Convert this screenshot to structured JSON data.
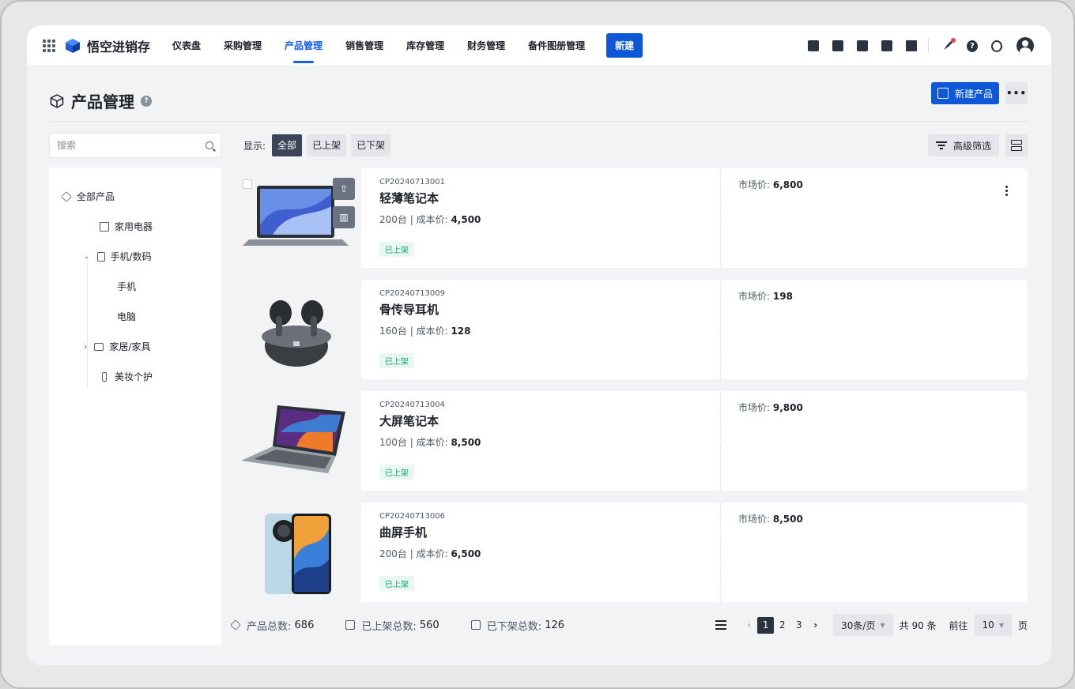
{
  "nav": {
    "brand": "悟空进销存",
    "items": [
      "仪表盘",
      "采购管理",
      "产品管理",
      "销售管理",
      "库存管理",
      "财务管理",
      "备件图册管理"
    ],
    "active_index": 2,
    "new_label": "新建"
  },
  "page": {
    "title": "产品管理",
    "help": "?",
    "new_product_label": "新建产品",
    "more_label": "•••"
  },
  "search": {
    "placeholder": "搜索"
  },
  "tree": {
    "root": "全部产品",
    "items": [
      "家用电器",
      "手机/数码",
      "手机",
      "电脑",
      "家居/家具",
      "美妆个护"
    ]
  },
  "filter": {
    "show_label": "显示:",
    "options": [
      "全部",
      "已上架",
      "已下架"
    ],
    "active_index": 0,
    "advanced_label": "高级筛选"
  },
  "products": [
    {
      "code": "CP20240713001",
      "name": "轻薄笔记本",
      "qty": "200台",
      "cost_label": "成本价:",
      "cost": "4,500",
      "status": "已上架",
      "market_label": "市场价:",
      "market": "6,800"
    },
    {
      "code": "CP20240713009",
      "name": "骨传导耳机",
      "qty": "160台",
      "cost_label": "成本价:",
      "cost": "128",
      "status": "已上架",
      "market_label": "市场价:",
      "market": "198"
    },
    {
      "code": "CP20240713004",
      "name": "大屏笔记本",
      "qty": "100台",
      "cost_label": "成本价:",
      "cost": "8,500",
      "status": "已上架",
      "market_label": "市场价:",
      "market": "9,800"
    },
    {
      "code": "CP20240713006",
      "name": "曲屏手机",
      "qty": "200台",
      "cost_label": "成本价:",
      "cost": "6,500",
      "status": "已上架",
      "market_label": "市场价:",
      "market": "8,500"
    }
  ],
  "footer": {
    "total_label": "产品总数:",
    "total": "686",
    "on_label": "已上架总数:",
    "on": "560",
    "off_label": "已下架总数:",
    "off": "126",
    "pages": [
      "1",
      "2",
      "3"
    ],
    "current_page": "1",
    "page_size": "30条/页",
    "total_text": "共 90 条",
    "goto_label": "前往",
    "goto_value": "10",
    "page_unit": "页"
  },
  "colors": {
    "primary": "#0e57d6",
    "active_nav": "#165dff",
    "status_green": "#00a870",
    "dark_chip": "#3b4456"
  }
}
